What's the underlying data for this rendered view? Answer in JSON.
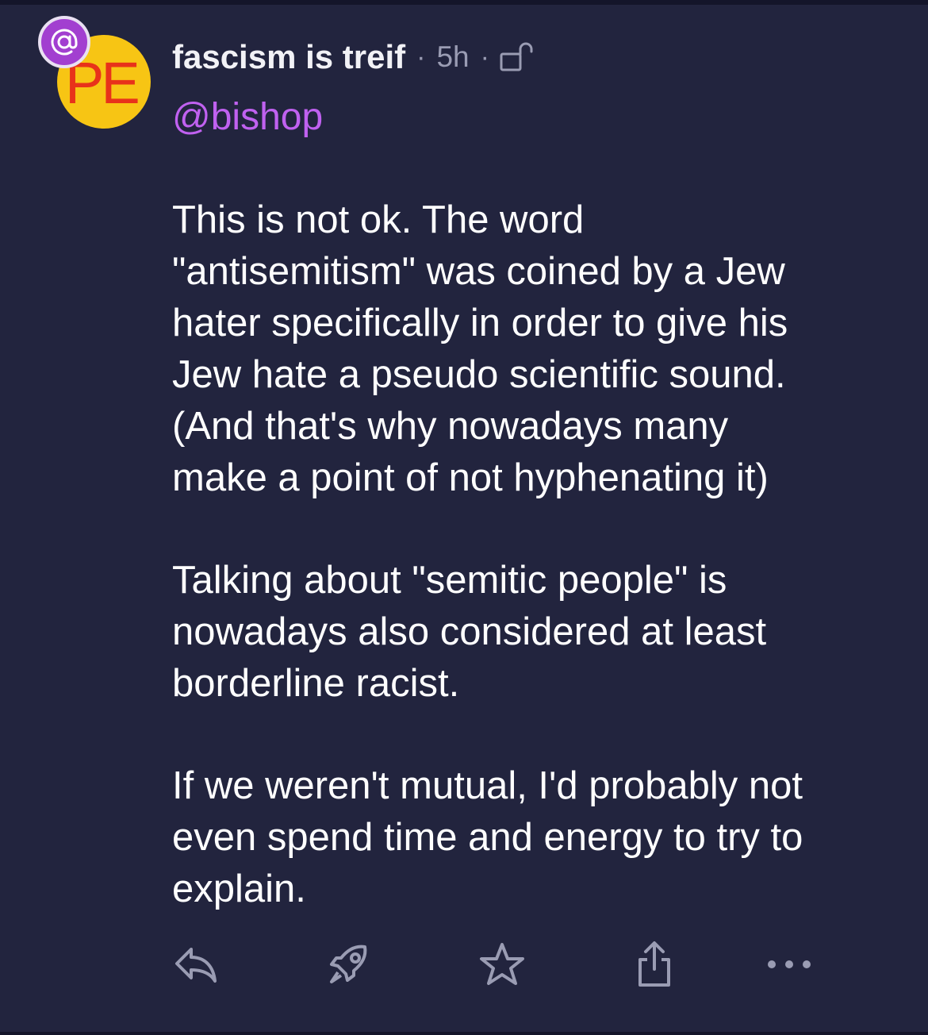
{
  "post": {
    "author": {
      "display_name": "fascism is treif",
      "handle": "@bishop",
      "avatar_text": "PE"
    },
    "meta": {
      "separator": "·",
      "time": "5h",
      "visibility_icon": "unlock-icon"
    },
    "badge_icon": "at-icon",
    "paragraphs": [
      "This is not ok. The word\n\"antisemitism\" was coined by a Jew\nhater specifically in order to give his\nJew hate a pseudo scientific sound.\n(And that's why nowadays many\nmake a point of not hyphenating it)",
      "Talking about \"semitic people\" is\nnowadays also considered at least\nborderline racist.",
      "If we weren't mutual, I'd probably not\neven spend time and energy to try to\nexplain."
    ],
    "actions": [
      "reply-icon",
      "boost-icon",
      "favourite-icon",
      "share-icon",
      "more-icon"
    ]
  },
  "colors": {
    "background": "#22243e",
    "text": "#ffffff",
    "muted": "#9a9cb3",
    "handle": "#c061f0",
    "avatar_bg": "#f7c514",
    "avatar_text": "#e8321a",
    "badge": "#a23fd0"
  }
}
